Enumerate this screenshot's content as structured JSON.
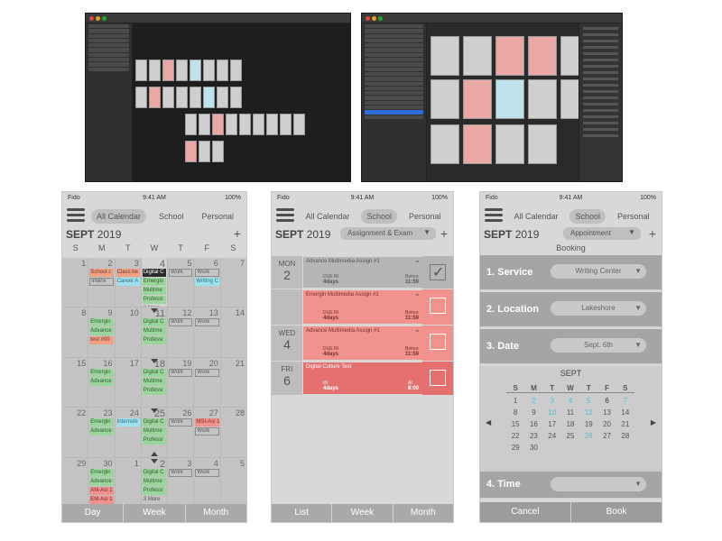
{
  "desktop": {
    "left_layers": [
      "Calendar: School 1 - day 1",
      "Calendar: School 1 - day 2",
      "Calendar: School 1 - day 3",
      "Calendar: School 1 - day 4",
      "Calendar: School 1 - day 5",
      "Calendar: School 1 - day 6",
      "Calendar: School 1 - day 7",
      "Calendar: School 1 - day 8",
      "Calendar: School 1 - day 9",
      "Calendar: School 1 - day 10"
    ],
    "right_layers": [
      "Calendar: School 1 - week 1",
      "Calendar: School 1 - week 2",
      "Calendar: School 1 - week 3",
      "Calendar: School 1 - week 4",
      "Calendar: School 1 - week 5",
      "Calendar: School 1 - week 6",
      "Calendar: School 1 - calendar",
      "Calendar: School dropdown",
      "Calendar: School month academic",
      "Calendar: School month designer",
      "Calendar: School month",
      "Calendar: School month add",
      "Calendar: School Exam month",
      "Calendar: School 1 - month",
      "Calendar: personal exam",
      "Calendar: personal month",
      "Calendar: personal 4 week",
      "Calendar: edit",
      "Calendar: School",
      "Calendar: All"
    ],
    "right_selected_layer": "Calendar: School Notifications",
    "inspector_device": "iPhone 8"
  },
  "status_bar": {
    "carrier": "Fido",
    "time": "9:41 AM",
    "battery": "100%"
  },
  "calendar_phone": {
    "tabs": [
      "All Calendar",
      "School",
      "Personal"
    ],
    "active_tab": "All Calendar",
    "month": "SEPT",
    "year": "2019",
    "add": "+",
    "weekdays": [
      "S",
      "M",
      "T",
      "W",
      "T",
      "F",
      "S"
    ],
    "weeks": [
      {
        "days": [
          "1",
          "2",
          "3",
          "4",
          "5",
          "6",
          "7"
        ],
        "events": [
          {
            "col": 1,
            "row": 0,
            "text": "School c",
            "color": "orange"
          },
          {
            "col": 1,
            "row": 1,
            "text": "Intervi",
            "color": "outline"
          },
          {
            "col": 2,
            "row": 0,
            "text": "Class be",
            "color": "orange"
          },
          {
            "col": 2,
            "row": 1,
            "text": "Career A",
            "color": "cyan"
          },
          {
            "col": 3,
            "row": 0,
            "text": "Digital C",
            "color": "dark"
          },
          {
            "col": 3,
            "row": 1,
            "text": "Emergin",
            "color": "green"
          },
          {
            "col": 3,
            "row": 2,
            "text": "Multime",
            "color": "green"
          },
          {
            "col": 3,
            "row": 3,
            "text": "Professi",
            "color": "green"
          },
          {
            "col": 3,
            "row": 4,
            "text": "3 More",
            "color": "more"
          },
          {
            "col": 4,
            "row": 0,
            "text": "Work",
            "color": "outline"
          },
          {
            "col": 5,
            "row": 0,
            "text": "Work",
            "color": "outline"
          },
          {
            "col": 5,
            "row": 1,
            "text": "Writing C",
            "color": "cyan"
          }
        ]
      },
      {
        "days": [
          "8",
          "9",
          "10",
          "11",
          "12",
          "13",
          "14"
        ],
        "events": [
          {
            "col": 1,
            "row": 0,
            "text": "Emergin",
            "color": "green"
          },
          {
            "col": 1,
            "row": 1,
            "text": "Advance",
            "color": "green"
          },
          {
            "col": 1,
            "row": 2,
            "text": "test #00",
            "color": "orange"
          },
          {
            "col": 3,
            "row": 0,
            "text": "Digital C",
            "color": "green"
          },
          {
            "col": 3,
            "row": 1,
            "text": "Multime",
            "color": "green"
          },
          {
            "col": 3,
            "row": 2,
            "text": "Professi",
            "color": "green"
          },
          {
            "col": 4,
            "row": 0,
            "text": "Work",
            "color": "outline"
          },
          {
            "col": 5,
            "row": 0,
            "text": "Work",
            "color": "outline"
          }
        ]
      },
      {
        "days": [
          "15",
          "16",
          "17",
          "18",
          "19",
          "20",
          "21"
        ],
        "events": [
          {
            "col": 1,
            "row": 0,
            "text": "Emergin",
            "color": "green"
          },
          {
            "col": 1,
            "row": 1,
            "text": "Advance",
            "color": "green"
          },
          {
            "col": 3,
            "row": 0,
            "text": "Digital C",
            "color": "green"
          },
          {
            "col": 3,
            "row": 1,
            "text": "Multime",
            "color": "green"
          },
          {
            "col": 3,
            "row": 2,
            "text": "Professi",
            "color": "green"
          },
          {
            "col": 4,
            "row": 0,
            "text": "Work",
            "color": "outline"
          },
          {
            "col": 5,
            "row": 0,
            "text": "Work",
            "color": "outline"
          }
        ]
      },
      {
        "days": [
          "22",
          "23",
          "24",
          "25",
          "26",
          "27",
          "28"
        ],
        "events": [
          {
            "col": 1,
            "row": 0,
            "text": "Emergin",
            "color": "green"
          },
          {
            "col": 1,
            "row": 1,
            "text": "Advance",
            "color": "green"
          },
          {
            "col": 2,
            "row": 0,
            "text": "Internshi",
            "color": "cyan"
          },
          {
            "col": 3,
            "row": 0,
            "text": "Digital C",
            "color": "green"
          },
          {
            "col": 3,
            "row": 1,
            "text": "Multime",
            "color": "green"
          },
          {
            "col": 3,
            "row": 2,
            "text": "Professi",
            "color": "green"
          },
          {
            "col": 4,
            "row": 0,
            "text": "Work",
            "color": "outline"
          },
          {
            "col": 5,
            "row": 0,
            "text": "MSI-Asi 1",
            "color": "red"
          },
          {
            "col": 5,
            "row": 1,
            "text": "Work",
            "color": "outline"
          }
        ]
      },
      {
        "days": [
          "29",
          "30",
          "1",
          "2",
          "3",
          "4",
          "5"
        ],
        "events": [
          {
            "col": 1,
            "row": 0,
            "text": "Emergin",
            "color": "green"
          },
          {
            "col": 1,
            "row": 1,
            "text": "Advance",
            "color": "green"
          },
          {
            "col": 1,
            "row": 2,
            "text": "AM-Asi 1",
            "color": "red"
          },
          {
            "col": 1,
            "row": 3,
            "text": "EM-Asi 1",
            "color": "red"
          },
          {
            "col": 3,
            "row": 0,
            "text": "Digital C",
            "color": "green"
          },
          {
            "col": 3,
            "row": 1,
            "text": "Multime",
            "color": "green"
          },
          {
            "col": 3,
            "row": 2,
            "text": "Professi",
            "color": "green"
          },
          {
            "col": 3,
            "row": 3,
            "text": "3 More",
            "color": "more"
          },
          {
            "col": 4,
            "row": 0,
            "text": "Work",
            "color": "outline"
          },
          {
            "col": 5,
            "row": 0,
            "text": "Work",
            "color": "outline"
          }
        ]
      }
    ],
    "bottom": [
      "Day",
      "Week",
      "Month"
    ]
  },
  "school_phone": {
    "tabs": [
      "All Calendar",
      "School",
      "Personal"
    ],
    "active_tab": "School",
    "month": "SEPT",
    "year": "2019",
    "filter": "Assignment & Exam",
    "add": "+",
    "rows": [
      {
        "dow": "MON",
        "day": "2",
        "title": "Advance Multimedia Assign #1",
        "left_label": "DUE IN",
        "left_value": "4days",
        "right_label": "Before",
        "right_value": "11:59",
        "color": "grey",
        "checked": true
      },
      {
        "dow": "",
        "day": "",
        "title": "Emergin Multimedia Assign #1",
        "left_label": "DUE IN",
        "left_value": "4days",
        "right_label": "Before",
        "right_value": "11:59",
        "color": "pink",
        "checked": false
      },
      {
        "dow": "WED",
        "day": "4",
        "title": "Advance Multimedia Assign #1",
        "left_label": "DUE IN",
        "left_value": "4days",
        "right_label": "Before",
        "right_value": "11:59",
        "color": "pink",
        "checked": false
      },
      {
        "dow": "FRI",
        "day": "6",
        "title": "Digital Culture Test",
        "left_label": "IN",
        "left_value": "4days",
        "right_label": "At",
        "right_value": "8:00",
        "color": "red",
        "checked": false
      }
    ],
    "bottom": [
      "List",
      "Week",
      "Month"
    ]
  },
  "booking_phone": {
    "tabs": [
      "All Calendar",
      "School",
      "Personal"
    ],
    "active_tab": "School",
    "month": "SEPT",
    "year": "2019",
    "filter": "Appointment",
    "add": "+",
    "heading": "Booking",
    "fields": [
      {
        "label": "1. Service",
        "value": "Writing Center"
      },
      {
        "label": "2. Location",
        "value": "Lakeshore"
      },
      {
        "label": "3. Date",
        "value": "Sept. 6th"
      }
    ],
    "mini_calendar": {
      "title": "SEPT",
      "headers": [
        "S",
        "M",
        "T",
        "W",
        "T",
        "F",
        "S"
      ],
      "days": [
        [
          "1",
          "2",
          "3",
          "4",
          "5",
          "6",
          "7"
        ],
        [
          "8",
          "9",
          "10",
          "11",
          "12",
          "13",
          "14"
        ],
        [
          "15",
          "16",
          "17",
          "18",
          "19",
          "20",
          "21"
        ],
        [
          "22",
          "23",
          "24",
          "25",
          "26",
          "27",
          "28"
        ],
        [
          "29",
          "30",
          "",
          "",
          "",
          "",
          ""
        ]
      ],
      "available": [
        "2",
        "3",
        "4",
        "5",
        "7",
        "10",
        "12",
        "26"
      ],
      "selected": "6",
      "prev": "◀",
      "next": "▶"
    },
    "time_label": "4. Time",
    "cancel": "Cancel",
    "book": "Book"
  }
}
